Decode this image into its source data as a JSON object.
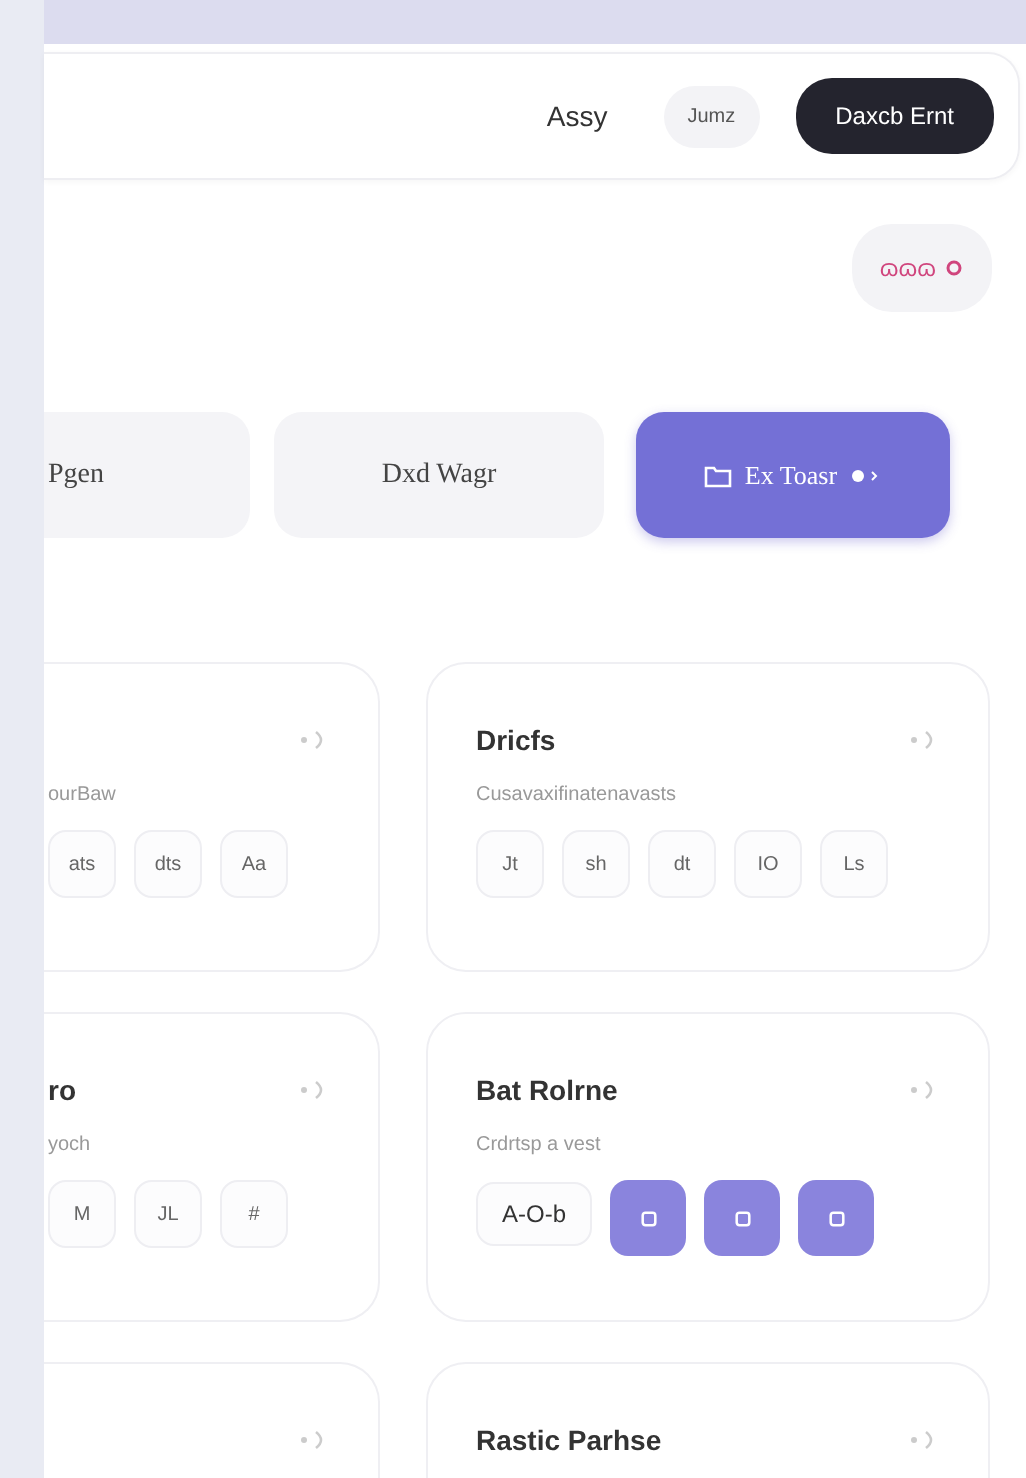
{
  "header": {
    "label": "Assy",
    "pill": "Jumz",
    "primary_button": "Daxcb Ernt"
  },
  "badge": {
    "text": "ɷɷɷ"
  },
  "tabs": [
    {
      "label": "Pgen",
      "selected": false
    },
    {
      "label": "Dxd Wagr",
      "selected": false
    },
    {
      "label": "Ex Toasr",
      "selected": true
    }
  ],
  "card_rows": [
    {
      "left": {
        "menu_icon": true,
        "subtitle": "ourBaw",
        "chips": [
          {
            "kind": "text",
            "label": "ats"
          },
          {
            "kind": "text",
            "label": "dts"
          },
          {
            "kind": "text",
            "label": "Aa"
          }
        ]
      },
      "right": {
        "menu_icon": true,
        "title": "Dricfs",
        "subtitle": "Cusavaxifinatenavasts",
        "chips": [
          {
            "kind": "text",
            "label": "Jt"
          },
          {
            "kind": "text",
            "label": "sh"
          },
          {
            "kind": "text",
            "label": "dt"
          },
          {
            "kind": "text",
            "label": "IO"
          },
          {
            "kind": "text",
            "label": "Ls"
          }
        ]
      }
    },
    {
      "left": {
        "menu_icon": true,
        "title": "ro",
        "subtitle": "yoch",
        "chips": [
          {
            "kind": "text",
            "label": "M"
          },
          {
            "kind": "text",
            "label": "JL"
          },
          {
            "kind": "text",
            "label": "#"
          }
        ]
      },
      "right": {
        "menu_icon": true,
        "title": "Bat Rolrne",
        "subtitle": "Crdrtsp a vest",
        "chips": [
          {
            "kind": "text",
            "label": "A-O-b"
          },
          {
            "kind": "icon"
          },
          {
            "kind": "icon"
          },
          {
            "kind": "icon"
          }
        ]
      }
    },
    {
      "left": {
        "menu_icon": true
      },
      "right": {
        "menu_icon": true,
        "title": "Rastic Parhse"
      }
    }
  ]
}
